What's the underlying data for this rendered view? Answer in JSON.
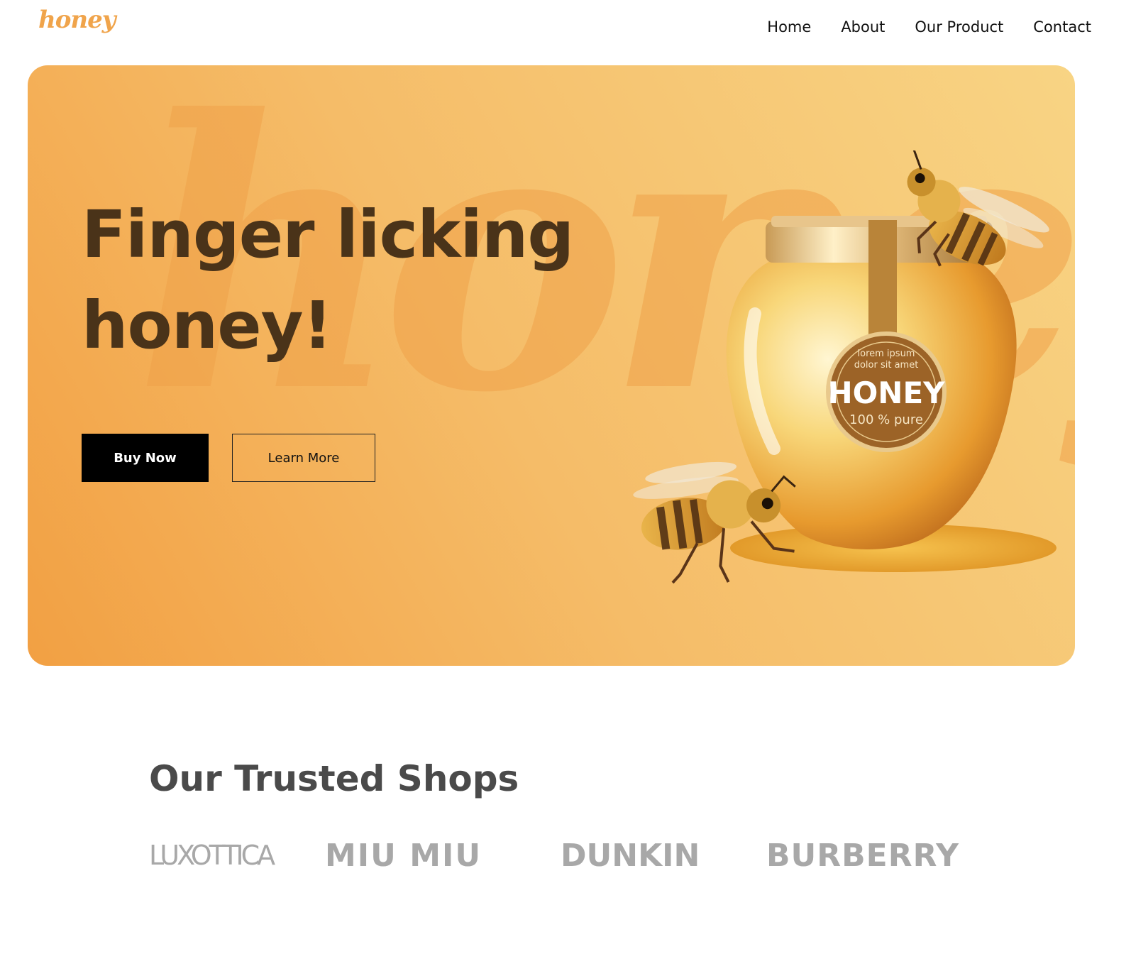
{
  "header": {
    "logo": "honey",
    "nav": [
      "Home",
      "About",
      "Our Product",
      "Contact"
    ]
  },
  "hero": {
    "watermark": "honey",
    "title_line1": "Finger licking",
    "title_line2": "honey!",
    "buy_label": "Buy Now",
    "learn_label": "Learn More",
    "jar_label_small1": "lorem ipsum",
    "jar_label_small2": "dolor sit amet",
    "jar_label_big": "HONEY",
    "jar_label_pure": "100 % pure"
  },
  "shops": {
    "title": "Our Trusted Shops",
    "brands": [
      "LUXOTTICA",
      "MIU MIU",
      "DUNKIN",
      "BURBERRY"
    ]
  },
  "colors": {
    "accent": "#F0A44B",
    "hero_dark_text": "#4A3319",
    "brand_gray": "#A8A8A8"
  }
}
